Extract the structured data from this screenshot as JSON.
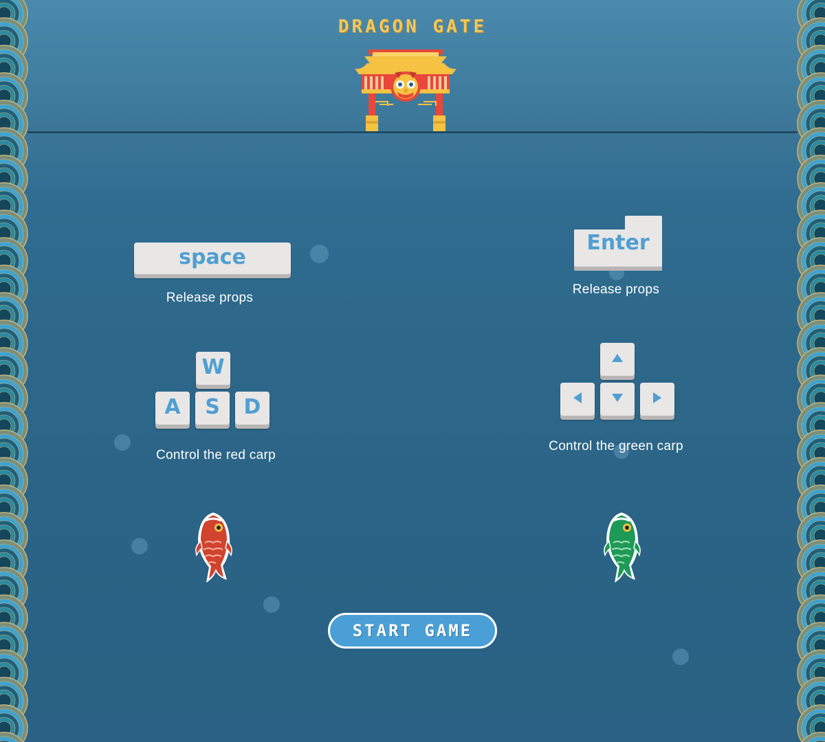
{
  "game": {
    "title": "DRAGON GATE",
    "start_button": "START GAME"
  },
  "player_red": {
    "props_key": "space",
    "props_caption": "Release props",
    "move_keys": {
      "up": "W",
      "left": "A",
      "down": "S",
      "right": "D"
    },
    "move_caption": "Control the red carp",
    "fish_color": "#d0432e"
  },
  "player_green": {
    "props_key": "Enter",
    "props_caption": "Release props",
    "move_keys": {
      "up": "up-arrow-icon",
      "left": "left-arrow-icon",
      "down": "down-arrow-icon",
      "right": "right-arrow-icon"
    },
    "move_caption": "Control the green carp",
    "fish_color": "#1e9a56"
  },
  "colors": {
    "water": "#2b6486",
    "key_text": "#4f9fd2",
    "title": "#f2c75c",
    "button": "#4aa0d6"
  }
}
